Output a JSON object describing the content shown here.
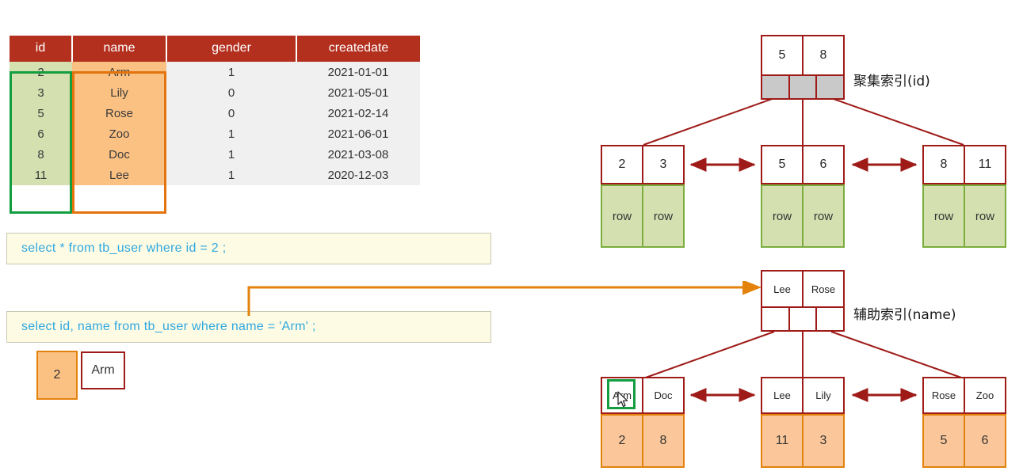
{
  "table": {
    "headers": [
      "id",
      "name",
      "gender",
      "createdate"
    ],
    "rows": [
      {
        "id": "2",
        "name": "Arm",
        "gender": "1",
        "createdate": "2021-01-01"
      },
      {
        "id": "3",
        "name": "Lily",
        "gender": "0",
        "createdate": "2021-05-01"
      },
      {
        "id": "5",
        "name": "Rose",
        "gender": "0",
        "createdate": "2021-02-14"
      },
      {
        "id": "6",
        "name": "Zoo",
        "gender": "1",
        "createdate": "2021-06-01"
      },
      {
        "id": "8",
        "name": "Doc",
        "gender": "1",
        "createdate": "2021-03-08"
      },
      {
        "id": "11",
        "name": "Lee",
        "gender": "1",
        "createdate": "2020-12-03"
      }
    ],
    "header_color": "#b3301f",
    "id_column_color": "#d4e0b0",
    "name_column_color": "#fbc183",
    "id_outline_color": "#139e3f",
    "name_outline_color": "#e3730d"
  },
  "sql": {
    "query_1": "select * from tb_user where id = 2 ;",
    "query_2": "select  id, name  from  tb_user  where  name = 'Arm' ;",
    "text_color": "#2fa8e0",
    "box_color": "#fdfbe4"
  },
  "result": {
    "id_value": "2",
    "name_value": "Arm"
  },
  "clustered_index": {
    "label": "聚集索引(id)",
    "root": {
      "keys": [
        "5",
        "8"
      ],
      "pointers": 3
    },
    "leaves": [
      {
        "keys": [
          "2",
          "3"
        ],
        "payload": [
          "row",
          "row"
        ]
      },
      {
        "keys": [
          "5",
          "6"
        ],
        "payload": [
          "row",
          "row"
        ]
      },
      {
        "keys": [
          "8",
          "11"
        ],
        "payload": [
          "row",
          "row"
        ]
      }
    ],
    "payload_color": "#d4e0b0",
    "border_color": "#9e1b18"
  },
  "secondary_index": {
    "label": "辅助索引(name)",
    "root": {
      "keys": [
        "Lee",
        "Rose"
      ],
      "pointers": 3
    },
    "leaves": [
      {
        "keys": [
          "Arm",
          "Doc"
        ],
        "payload": [
          "2",
          "8"
        ]
      },
      {
        "keys": [
          "Lee",
          "Lily"
        ],
        "payload": [
          "11",
          "3"
        ]
      },
      {
        "keys": [
          "Rose",
          "Zoo"
        ],
        "payload": [
          "5",
          "6"
        ]
      }
    ],
    "payload_color": "#fbc79a",
    "border_color": "#9e1b18",
    "highlighted_key": "Arm",
    "highlight_color": "#139e3f"
  },
  "connector": {
    "color": "#e3820d"
  }
}
